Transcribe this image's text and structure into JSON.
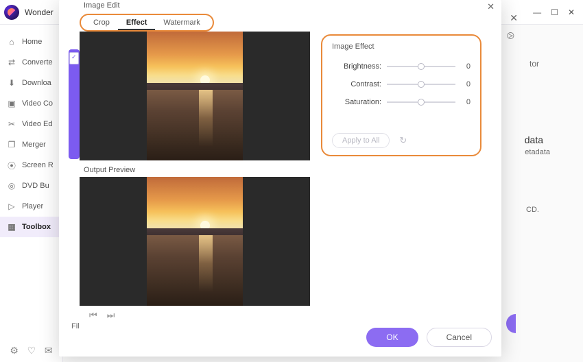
{
  "app": {
    "title": "Wonder"
  },
  "window_controls": {
    "min": "—",
    "max": "☐",
    "close": "✕"
  },
  "inner_close": "✕",
  "sidebar": {
    "items": [
      {
        "label": "Home",
        "icon": "⌂"
      },
      {
        "label": "Converte",
        "icon": "⇄"
      },
      {
        "label": "Downloa",
        "icon": "⬇"
      },
      {
        "label": "Video Co",
        "icon": "▣"
      },
      {
        "label": "Video Ed",
        "icon": "✂"
      },
      {
        "label": "Merger",
        "icon": "❐"
      },
      {
        "label": "Screen R",
        "icon": "⦿"
      },
      {
        "label": "DVD Bu",
        "icon": "◎"
      },
      {
        "label": "Player",
        "icon": "▷"
      },
      {
        "label": "Toolbox",
        "icon": "▦"
      }
    ],
    "bottom": {
      "gear": "⚙",
      "bell": "♡",
      "mail": "✉"
    }
  },
  "background": {
    "tor": "tor",
    "data": "data",
    "etadata": "etadata",
    "cd": "CD.",
    "camera": "⧁"
  },
  "dialog": {
    "title": "Image Edit",
    "close": "✕",
    "tabs": {
      "crop": "Crop",
      "effect": "Effect",
      "watermark": "Watermark"
    },
    "output_label": "Output Preview",
    "file_label": "Fil",
    "transport": {
      "prev": "⏮",
      "next": "⏭"
    },
    "fx": {
      "title": "Image Effect",
      "rows": [
        {
          "label": "Brightness:",
          "value": "0",
          "pos": 50
        },
        {
          "label": "Contrast:",
          "value": "0",
          "pos": 50
        },
        {
          "label": "Saturation:",
          "value": "0",
          "pos": 50
        }
      ],
      "apply_all": "Apply to All",
      "reset": "↻"
    },
    "ok": "OK",
    "cancel": "Cancel"
  }
}
